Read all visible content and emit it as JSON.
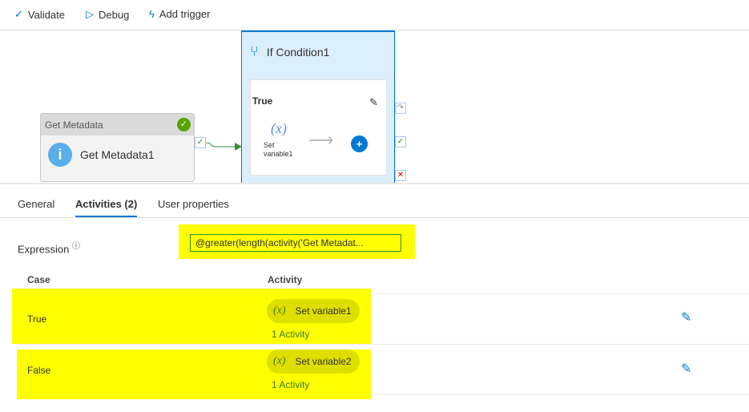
{
  "toolbar": {
    "validate": "Validate",
    "debug": "Debug",
    "add_trigger": "Add trigger"
  },
  "canvas": {
    "get_metadata": {
      "type_label": "Get Metadata",
      "name": "Get Metadata1"
    },
    "if_condition": {
      "name": "If Condition1",
      "branch_label": "True",
      "inner_activity": "Set variable1",
      "inner_activity_line1": "Set",
      "inner_activity_line2": "variable1"
    }
  },
  "tabs": [
    {
      "label": "General"
    },
    {
      "label": "Activities (2)",
      "active": true
    },
    {
      "label": "User properties"
    }
  ],
  "expression": {
    "label": "Expression",
    "value": "@greater(length(activity('Get Metadat..."
  },
  "table": {
    "headers": {
      "case": "Case",
      "activity": "Activity"
    },
    "rows": [
      {
        "case": "True",
        "activity": "Set variable1",
        "count": "1 Activity"
      },
      {
        "case": "False",
        "activity": "Set variable2",
        "count": "1 Activity"
      }
    ]
  },
  "colors": {
    "accent": "#0078d4",
    "highlight": "#ffff00",
    "success": "#57a300"
  }
}
